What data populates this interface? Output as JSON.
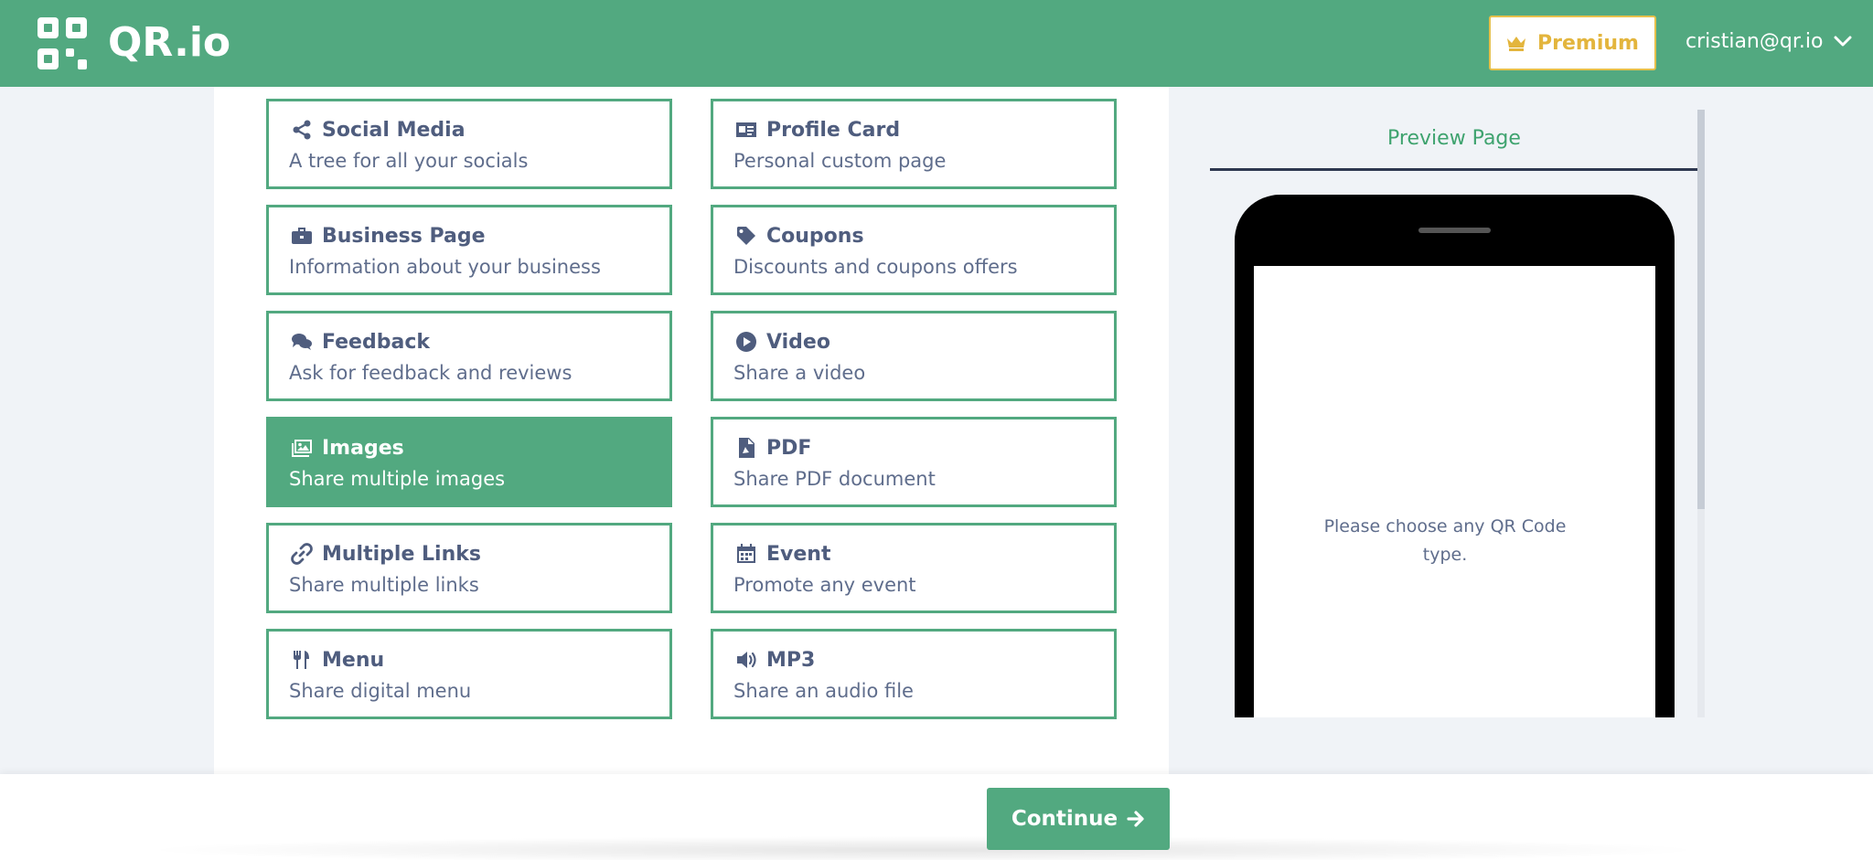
{
  "header": {
    "brand": "QR.io",
    "logo_icon": "qr-logo-icon",
    "premium_label": "Premium",
    "premium_icon": "crown-icon",
    "user_email": "cristian@qr.io",
    "user_menu_icon": "chevron-down-icon",
    "colors": {
      "bar": "#52a980",
      "premium": "#e3b53d"
    }
  },
  "types": [
    {
      "title": "Social Media",
      "desc": "A tree for all your socials",
      "icon": "share-icon",
      "selected": false
    },
    {
      "title": "Profile Card",
      "desc": "Personal custom page",
      "icon": "id-card-icon",
      "selected": false
    },
    {
      "title": "Business Page",
      "desc": "Information about your business",
      "icon": "briefcase-icon",
      "selected": false
    },
    {
      "title": "Coupons",
      "desc": "Discounts and coupons offers",
      "icon": "tag-icon",
      "selected": false
    },
    {
      "title": "Feedback",
      "desc": "Ask for feedback and reviews",
      "icon": "comments-icon",
      "selected": false
    },
    {
      "title": "Video",
      "desc": "Share a video",
      "icon": "play-circle-icon",
      "selected": false
    },
    {
      "title": "Images",
      "desc": "Share multiple images",
      "icon": "images-icon",
      "selected": true
    },
    {
      "title": "PDF",
      "desc": "Share PDF document",
      "icon": "pdf-file-icon",
      "selected": false
    },
    {
      "title": "Multiple Links",
      "desc": "Share multiple links",
      "icon": "link-icon",
      "selected": false
    },
    {
      "title": "Event",
      "desc": "Promote any event",
      "icon": "calendar-icon",
      "selected": false
    },
    {
      "title": "Menu",
      "desc": "Share digital menu",
      "icon": "utensils-icon",
      "selected": false
    },
    {
      "title": "MP3",
      "desc": "Share an audio file",
      "icon": "volume-icon",
      "selected": false
    }
  ],
  "preview": {
    "tab_label": "Preview Page",
    "hint": "Please choose any QR Code type."
  },
  "footer": {
    "continue_label": "Continue",
    "continue_icon": "arrow-right-icon"
  }
}
